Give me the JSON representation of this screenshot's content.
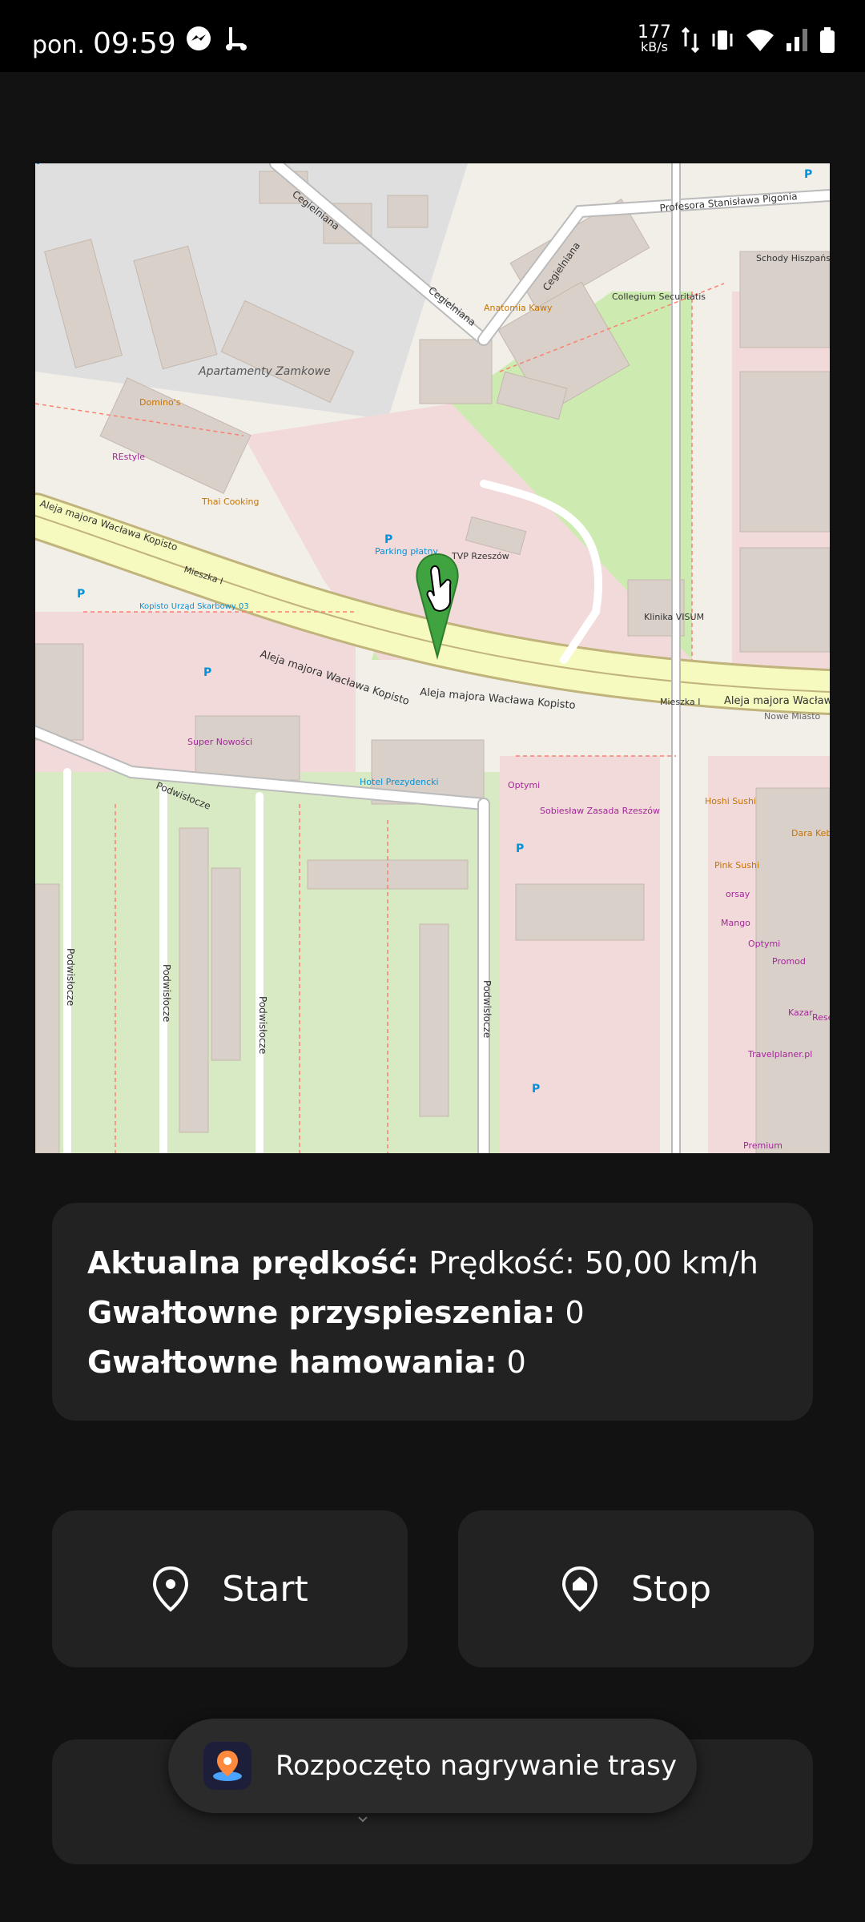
{
  "status_bar": {
    "day": "pon.",
    "time": "09:59",
    "net_speed": "177",
    "net_unit": "kB/s",
    "icons": [
      "messenger-icon",
      "scooter-icon",
      "data-arrows-icon",
      "vibrate-icon",
      "wifi-icon",
      "signal-icon",
      "battery-icon"
    ]
  },
  "map": {
    "labels": {
      "street_main": "Aleja majora Wacława Kopisto",
      "street_cegielniana": "Cegielniana",
      "street_pigonia": "Profesora Stanisława Pigonia",
      "street_podwislocze": "Podwisłocze",
      "street_mieszka": "Mieszka I",
      "nowe_miasto": "Nowe Miasto",
      "apartamenty": "Apartamenty Zamkowe",
      "tvp": "TVP Rzeszów",
      "parking": "Parking płatny",
      "klinika": "Klinika VISUM",
      "collegium": "Collegium Securitatis",
      "schody": "Schody Hiszpańskie",
      "hotel": "Hotel Prezydencki",
      "sobieslaw": "Sobiesław Zasada Rzeszów",
      "super_nowosci": "Super Nowości",
      "kopisto": "Kopisto Urząd Skarbowy 03",
      "dominos": "Domino's",
      "restyle": "REstyle",
      "thai": "Thai Cooking",
      "anatomia": "Anatomia Kawy",
      "hoshi": "Hoshi Sushi",
      "dara": "Dara Kebab",
      "pink": "Pink Sushi",
      "orsay": "orsay",
      "mango": "Mango",
      "optymi": "Optymi",
      "promod": "Promod",
      "kazar": "Kazar",
      "travel": "Travelplaner.pl",
      "premium": "Premium",
      "reserved": "Rese",
      "optymi2": "Optymi"
    }
  },
  "info": {
    "speed_label": "Aktualna prędkość:",
    "speed_value": "Prędkość: 50,00 km/h",
    "accel_label": "Gwałtowne przyspieszenia:",
    "accel_value": "0",
    "brake_label": "Gwałtowne hamowania:",
    "brake_value": "0"
  },
  "buttons": {
    "start_label": "Start",
    "stop_label": "Stop",
    "start_icon": "location-pin-icon",
    "stop_icon": "location-home-pin-icon"
  },
  "toast": {
    "text": "Rozpoczęto nagrywanie trasy",
    "icon": "route-app-icon"
  },
  "colors": {
    "background": "#121212",
    "card": "#222222",
    "marker_green": "#3fa33f"
  }
}
